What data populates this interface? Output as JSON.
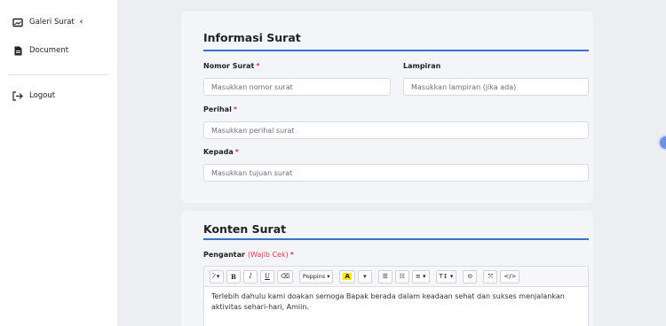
{
  "sidebar": {
    "items": [
      {
        "label": "Galeri Surat",
        "icon": "gallery-icon",
        "chevron": "‹"
      },
      {
        "label": "Document",
        "icon": "document-icon"
      },
      {
        "label": "Logout",
        "icon": "logout-icon"
      }
    ]
  },
  "info_section": {
    "title": "Informasi Surat",
    "nomor": {
      "label": "Nomor Surat",
      "required": "*",
      "placeholder": "Masukkan nomor surat"
    },
    "lampiran": {
      "label": "Lampiran",
      "placeholder": "Masukkan lampiran (jika ada)"
    },
    "perihal": {
      "label": "Perihal",
      "required": "*",
      "placeholder": "Masukkan perihal surat"
    },
    "kepada": {
      "label": "Kepada",
      "required": "*",
      "placeholder": "Masukkan tujuan surat"
    }
  },
  "content_section": {
    "title": "Konten Surat",
    "pengantar": {
      "label": "Pengantar",
      "note": "(Wajib Cek)",
      "required": "*",
      "toolbar": {
        "magic": "⁄̄ ▾",
        "bold": "B",
        "italic": "I",
        "underline": "U",
        "eraser": "⌫",
        "font": "Poppins ▾",
        "highlight": "A",
        "highlight_caret": "▾",
        "ul": "☰",
        "ol": "☷",
        "align": "≡ ▾",
        "size": "T↕ ▾",
        "link": "⊝",
        "fullscreen": "⤧",
        "code": "</>"
      },
      "text": "Terlebih dahulu kami doakan semoga Bapak berada dalam keadaan sehat dan sukses menjalankan aktivitas sehari-hari, Amiin."
    }
  },
  "colors": {
    "accent": "#3b6fc9",
    "required": "#e2364b",
    "highlight": "#ffe500"
  }
}
